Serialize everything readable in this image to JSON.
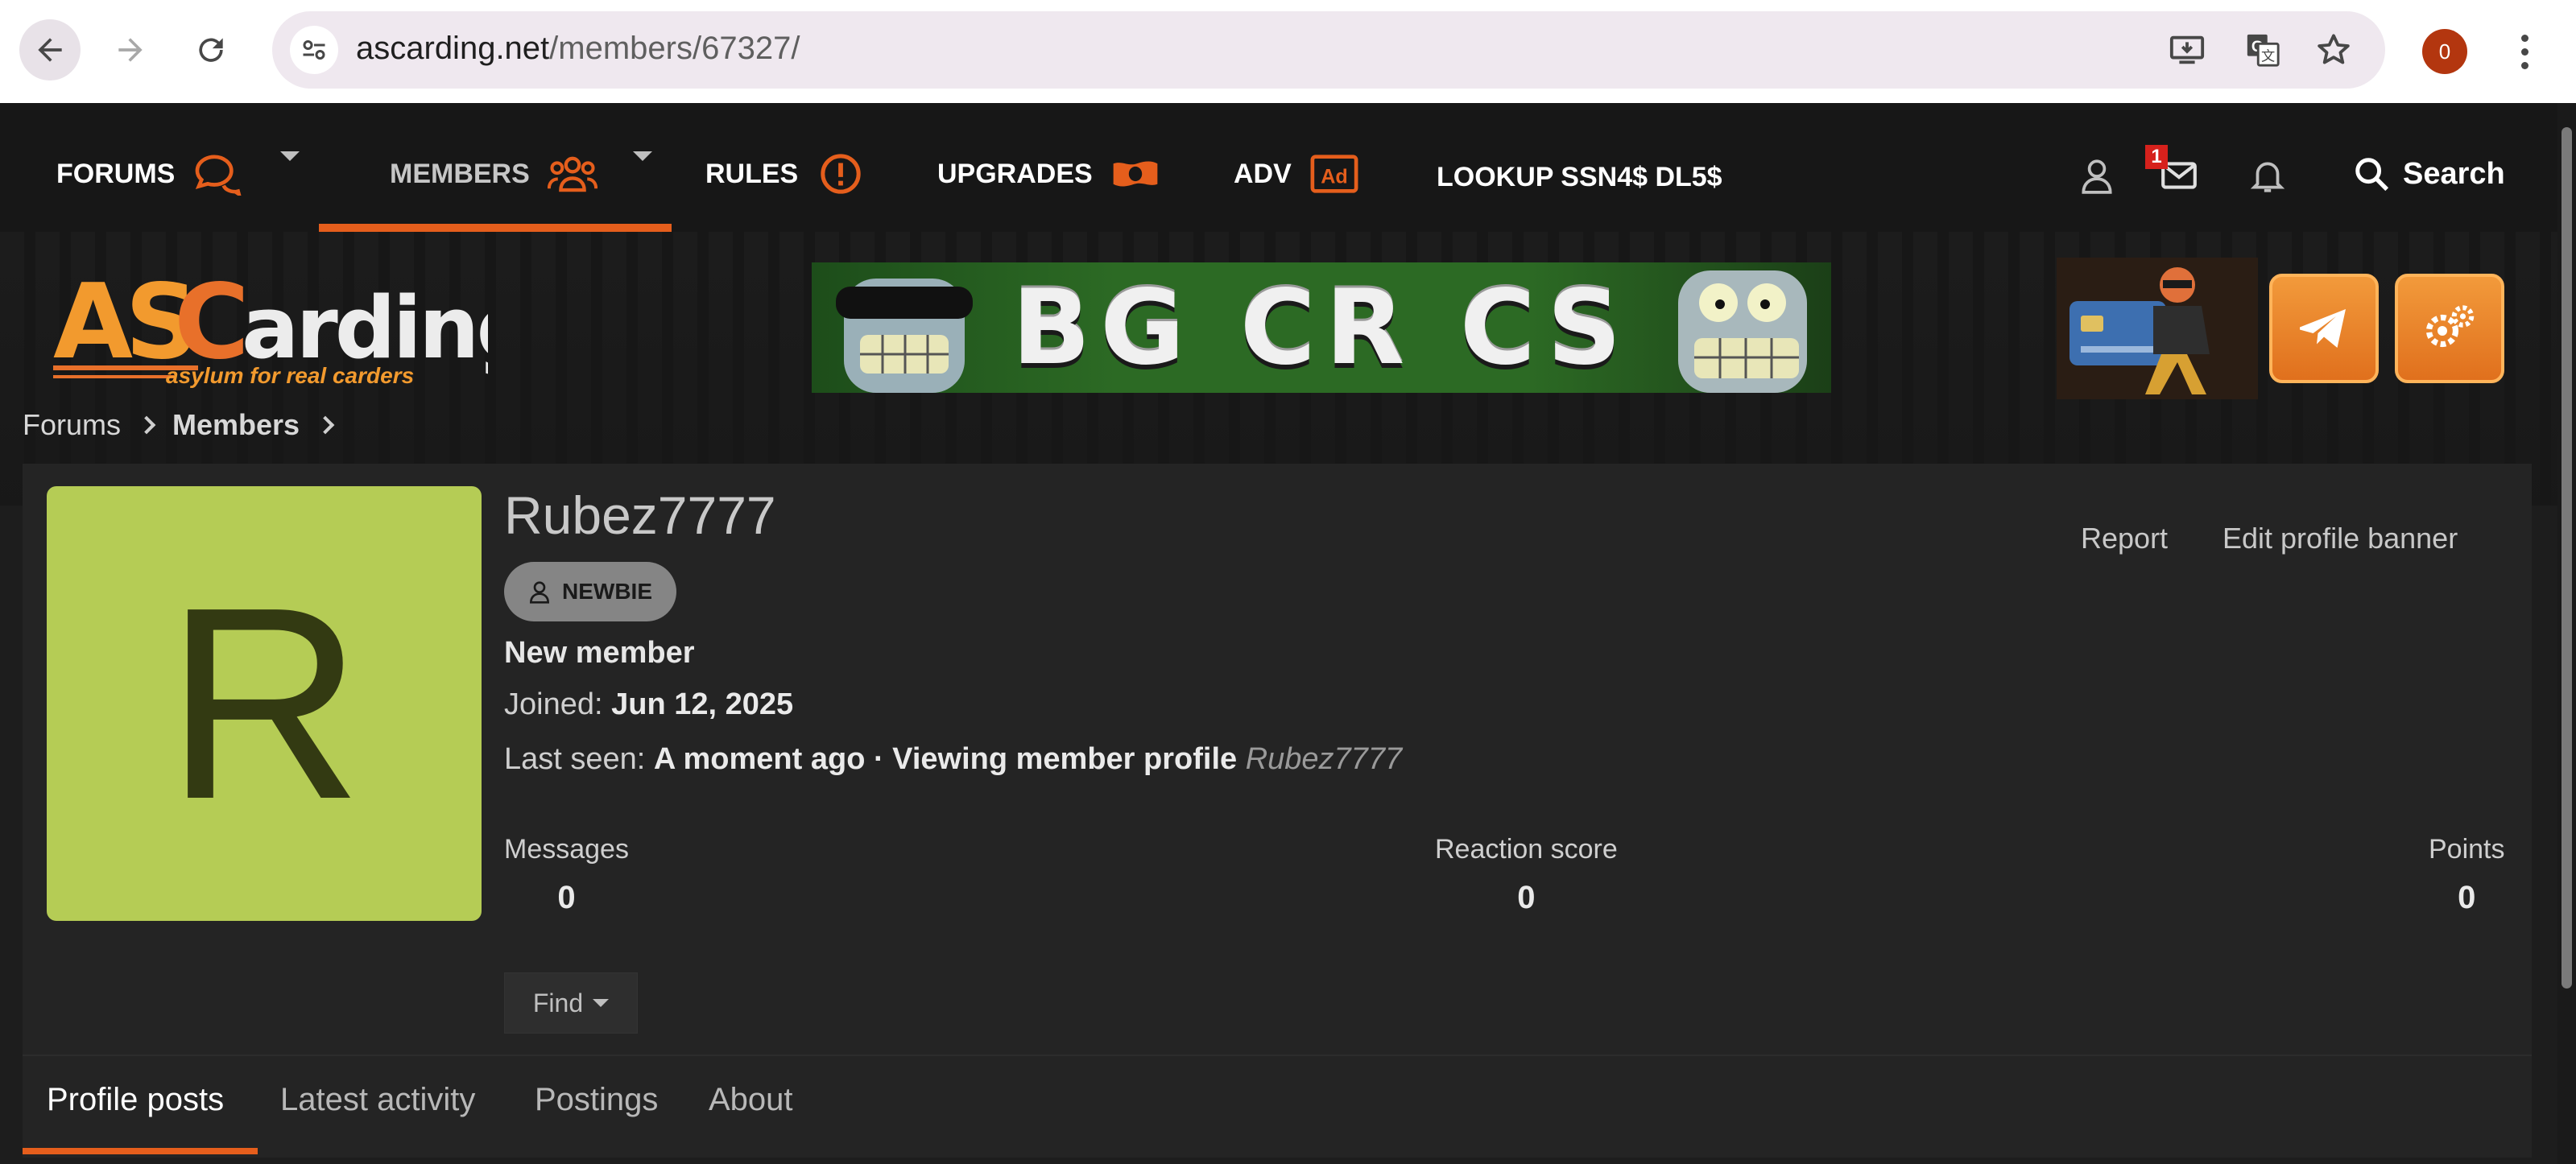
{
  "browser": {
    "url_host": "ascarding.net",
    "url_path": "/members/67327/",
    "profile_initial": "0",
    "icons": [
      "back-icon",
      "forward-icon",
      "reload-icon",
      "site-info-icon",
      "install-app-icon",
      "translate-icon",
      "bookmark-star-icon",
      "more-menu-icon"
    ]
  },
  "nav": {
    "items": [
      {
        "label": "FORUMS",
        "icon": "chat-bubbles-icon"
      },
      {
        "label": "MEMBERS",
        "icon": "users-group-icon"
      },
      {
        "label": "RULES",
        "icon": "alert-circle-icon"
      },
      {
        "label": "UPGRADES",
        "icon": "money-bill-icon"
      },
      {
        "label": "ADV",
        "icon": "ad-icon"
      },
      {
        "label": "LOOKUP SSN4$ DL5$",
        "icon": ""
      }
    ],
    "active_item": "MEMBERS",
    "messages_badge": "1",
    "search_label": "Search",
    "accent_color": "#e55e1c"
  },
  "header": {
    "logo_tagline": "asylum for real carders",
    "banner_text": "BG CR CS"
  },
  "breadcrumb": [
    "Forums",
    "Members"
  ],
  "profile": {
    "avatar_letter": "R",
    "avatar_color": "#b5cc55",
    "username": "Rubez7777",
    "badge": "NEWBIE",
    "title": "New member",
    "joined_label": "Joined:",
    "joined_value": "Jun 12, 2025",
    "last_seen_label": "Last seen:",
    "last_seen_value": "A moment ago · Viewing member profile",
    "last_seen_target": "Rubez7777",
    "actions": {
      "report": "Report",
      "edit_banner": "Edit profile banner"
    },
    "stats": [
      {
        "label": "Messages",
        "value": "0"
      },
      {
        "label": "Reaction score",
        "value": "0"
      },
      {
        "label": "Points",
        "value": "0"
      }
    ],
    "find_label": "Find"
  },
  "tabs": [
    "Profile posts",
    "Latest activity",
    "Postings",
    "About"
  ],
  "active_tab": "Profile posts"
}
